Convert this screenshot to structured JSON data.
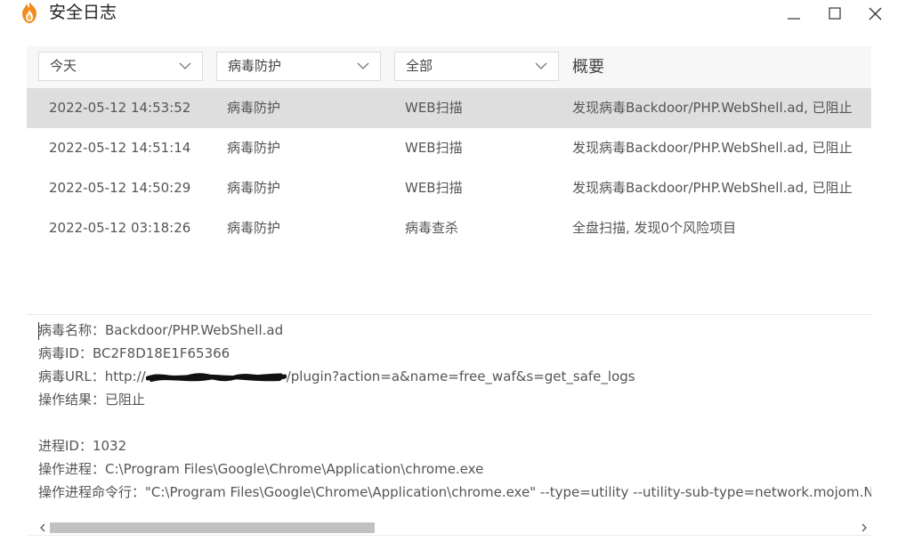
{
  "window": {
    "title": "安全日志",
    "icons": [
      "flame-shield-icon",
      "minimize-icon",
      "maximize-icon",
      "close-icon"
    ]
  },
  "filters": {
    "date": "今天",
    "category": "病毒防护",
    "action": "全部",
    "summary_header": "概要"
  },
  "logs": [
    {
      "time": "2022-05-12 14:53:52",
      "type": "病毒防护",
      "action": "WEB扫描",
      "summary": "发现病毒Backdoor/PHP.WebShell.ad, 已阻止",
      "selected": true
    },
    {
      "time": "2022-05-12 14:51:14",
      "type": "病毒防护",
      "action": "WEB扫描",
      "summary": "发现病毒Backdoor/PHP.WebShell.ad, 已阻止",
      "selected": false
    },
    {
      "time": "2022-05-12 14:50:29",
      "type": "病毒防护",
      "action": "WEB扫描",
      "summary": "发现病毒Backdoor/PHP.WebShell.ad, 已阻止",
      "selected": false
    },
    {
      "time": "2022-05-12 03:18:26",
      "type": "病毒防护",
      "action": "病毒查杀",
      "summary": "全盘扫描, 发现0个风险项目",
      "selected": false
    }
  ],
  "details": {
    "virus_name": "病毒名称：Backdoor/PHP.WebShell.ad",
    "virus_id": "病毒ID：BC2F8D18E1F65366",
    "virus_url_prefix": "病毒URL：http://",
    "virus_url_suffix": "/plugin?action=a&name=free_waf&s=get_safe_logs",
    "result": "操作结果：已阻止",
    "process_id": "进程ID：1032",
    "process": "操作进程：C:\\Program Files\\Google\\Chrome\\Application\\chrome.exe",
    "process_cmd": "操作进程命令行：\"C:\\Program Files\\Google\\Chrome\\Application\\chrome.exe\" --type=utility --utility-sub-type=network.mojom.NetworkService"
  },
  "colors": {
    "selected_row": "#dedede",
    "header_bg": "#f7f7f7",
    "flame_orange": "#f28a1e",
    "scroll_thumb": "#c1c1c1"
  }
}
